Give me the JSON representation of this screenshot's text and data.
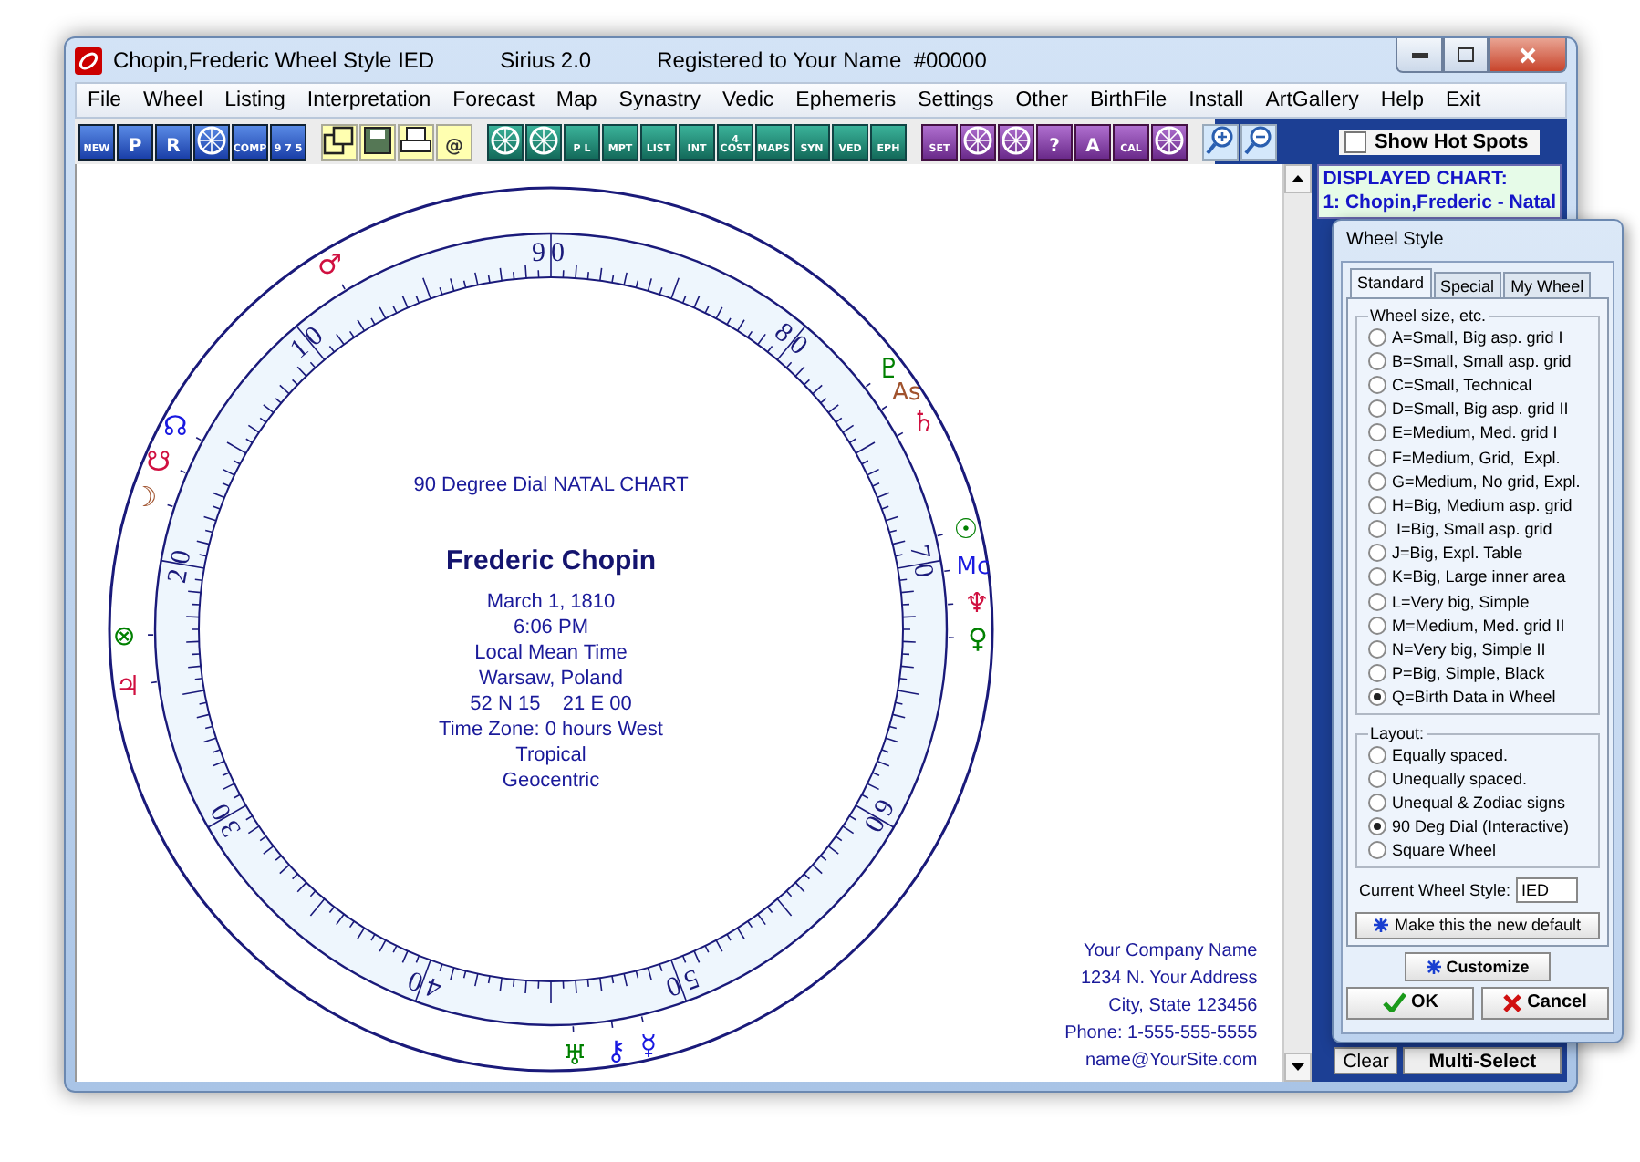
{
  "window": {
    "title": "Chopin,Frederic Wheel Style IED",
    "app": "Sirius 2.0",
    "registration": "Registered to Your Name  #00000"
  },
  "menu": [
    "File",
    "Wheel",
    "Listing",
    "Interpretation",
    "Forecast",
    "Map",
    "Synastry",
    "Vedic",
    "Ephemeris",
    "Settings",
    "Other",
    "BirthFile",
    "Install",
    "ArtGallery",
    "Help",
    "Exit"
  ],
  "toolbar": [
    {
      "kind": "chart",
      "buttons": [
        {
          "kind": "text",
          "caption": "NEW"
        },
        {
          "kind": "text",
          "caption": "P"
        },
        {
          "kind": "text",
          "caption": "R"
        },
        {
          "kind": "icon"
        },
        {
          "kind": "text",
          "caption": "COMP"
        },
        {
          "kind": "text",
          "caption": "9 7 5"
        }
      ]
    },
    {
      "kind": "file",
      "buttons": [
        {
          "kind": "icon"
        },
        {
          "kind": "icon"
        },
        {
          "kind": "icon"
        },
        {
          "kind": "text",
          "caption": "@"
        }
      ]
    },
    {
      "kind": "report",
      "buttons": [
        {
          "kind": "icon"
        },
        {
          "kind": "icon"
        },
        {
          "kind": "text",
          "caption": "P L"
        },
        {
          "kind": "text",
          "caption": "MPT"
        },
        {
          "kind": "text",
          "caption": "LIST"
        },
        {
          "kind": "text",
          "caption": "INT"
        },
        {
          "kind": "text",
          "caption": "4 COST"
        },
        {
          "kind": "text",
          "caption": "MAPS"
        },
        {
          "kind": "text",
          "caption": "SYN"
        },
        {
          "kind": "text",
          "caption": "VED"
        },
        {
          "kind": "text",
          "caption": "EPH"
        }
      ]
    },
    {
      "kind": "tools",
      "buttons": [
        {
          "kind": "text",
          "caption": "SET"
        },
        {
          "kind": "icon"
        },
        {
          "kind": "icon"
        },
        {
          "kind": "text",
          "caption": "?"
        },
        {
          "kind": "text",
          "caption": "A"
        },
        {
          "kind": "text",
          "caption": "CAL"
        },
        {
          "kind": "icon"
        }
      ]
    },
    {
      "kind": "zoom",
      "buttons": [
        {
          "kind": "icon"
        },
        {
          "kind": "icon"
        }
      ]
    }
  ],
  "hot_spots": {
    "label": "Show Hot Spots",
    "checked": false
  },
  "displayed_chart": {
    "heading": "DISPLAYED CHART:",
    "name": "1: Chopin,Frederic - Natal"
  },
  "side_buttons": [
    "Clear",
    "Multi-Select"
  ],
  "chart": {
    "title": "90 Degree Dial NATAL CHART",
    "name": "Frederic Chopin",
    "details": [
      "March 1, 1810",
      "6:06 PM",
      "Local Mean Time",
      "Warsaw, Poland",
      "52 N 15    21 E 00",
      "Time Zone: 0 hours West",
      "Tropical",
      "Geocentric"
    ],
    "dial_labels": [
      "90",
      "10",
      "20",
      "30",
      "40",
      "50",
      "60",
      "70",
      "80"
    ],
    "planets": [
      {
        "glyph": "♂",
        "color": "#d01040"
      },
      {
        "glyph": "♇",
        "color": "#008000"
      },
      {
        "glyph": "As",
        "color": "#a0522d"
      },
      {
        "glyph": "♄",
        "color": "#d01040"
      },
      {
        "glyph": "☊",
        "color": "#1818e0"
      },
      {
        "glyph": "☋",
        "color": "#d01040"
      },
      {
        "glyph": "☽",
        "color": "#a0522d"
      },
      {
        "glyph": "☉",
        "color": "#008000"
      },
      {
        "glyph": "Mc",
        "color": "#1818e0"
      },
      {
        "glyph": "♆",
        "color": "#d01040"
      },
      {
        "glyph": "⊗",
        "color": "#008000"
      },
      {
        "glyph": "♀",
        "color": "#008000"
      },
      {
        "glyph": "♃",
        "color": "#d01040"
      },
      {
        "glyph": "♅",
        "color": "#008000"
      },
      {
        "glyph": "⚷",
        "color": "#1818e0"
      },
      {
        "glyph": "☿",
        "color": "#1818e0"
      }
    ]
  },
  "company": [
    "Your Company Name",
    "1234 N. Your Address",
    "City, State 123456",
    "Phone: 1-555-555-5555",
    "name@YourSite.com"
  ],
  "dialog": {
    "title": "Wheel Style",
    "tabs": [
      {
        "label": "Standard",
        "selected": true
      },
      {
        "label": "Special",
        "selected": false
      },
      {
        "label": "My Wheel",
        "selected": false
      }
    ],
    "size_group": {
      "label": "Wheel size, etc.",
      "options": [
        {
          "label": "A=Small, Big asp. grid I",
          "selected": false
        },
        {
          "label": "B=Small, Small asp. grid",
          "selected": false
        },
        {
          "label": "C=Small, Technical",
          "selected": false
        },
        {
          "label": "D=Small, Big asp. grid II",
          "selected": false
        },
        {
          "label": "E=Medium, Med. grid I",
          "selected": false
        },
        {
          "label": "F=Medium, Grid,  Expl.",
          "selected": false
        },
        {
          "label": "G=Medium, No grid, Expl.",
          "selected": false
        },
        {
          "label": "H=Big, Medium asp. grid",
          "selected": false
        },
        {
          "label": " I=Big, Small asp. grid",
          "selected": false
        },
        {
          "label": "J=Big, Expl. Table",
          "selected": false
        },
        {
          "label": "K=Big, Large inner area",
          "selected": false
        },
        {
          "label": "L=Very big, Simple",
          "selected": false
        },
        {
          "label": "M=Medium, Med. grid II",
          "selected": false
        },
        {
          "label": "N=Very big, Simple II",
          "selected": false
        },
        {
          "label": "P=Big, Simple, Black",
          "selected": false
        },
        {
          "label": "Q=Birth Data in Wheel",
          "selected": true
        }
      ]
    },
    "layout_group": {
      "label": "Layout:",
      "options": [
        {
          "label": "Equally spaced.",
          "selected": false
        },
        {
          "label": "Unequally spaced.",
          "selected": false
        },
        {
          "label": "Unequal & Zodiac signs",
          "selected": false
        },
        {
          "label": "90 Deg Dial (Interactive)",
          "selected": true
        },
        {
          "label": "Square Wheel",
          "selected": false
        }
      ]
    },
    "current_style": {
      "label": "Current Wheel Style:",
      "value": "IED"
    },
    "default_button": "Make this the new default",
    "customize_button": "Customize",
    "ok_button": "OK",
    "cancel_button": "Cancel"
  }
}
